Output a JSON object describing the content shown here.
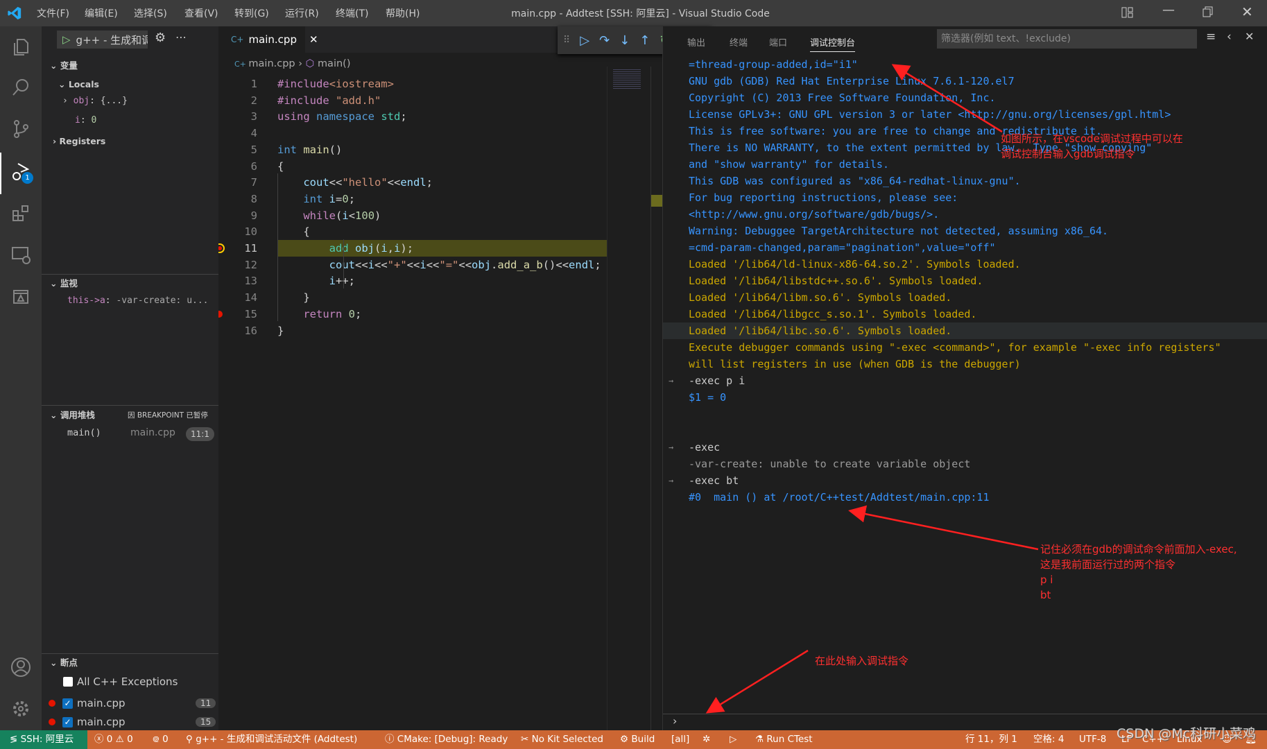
{
  "window": {
    "title": "main.cpp - Addtest [SSH: 阿里云] - Visual Studio Code",
    "menu": [
      "文件(F)",
      "编辑(E)",
      "选择(S)",
      "查看(V)",
      "转到(G)",
      "运行(R)",
      "终端(T)",
      "帮助(H)"
    ]
  },
  "sidebar": {
    "run_config": "g++ - 生成和调",
    "variables": {
      "title": "变量",
      "locals_label": "Locals",
      "items": [
        {
          "name": "obj",
          "value": "{...}"
        },
        {
          "name": "i",
          "value": "0"
        }
      ],
      "registers_label": "Registers"
    },
    "watch": {
      "title": "监视",
      "items": [
        {
          "expr": "this->a",
          "value": "-var-create: u..."
        }
      ]
    },
    "callstack": {
      "title": "调用堆栈",
      "status": "因 BREAKPOINT 已暂停",
      "frames": [
        {
          "name": "main()",
          "file": "main.cpp",
          "pos": "11:1"
        }
      ]
    },
    "breakpoints": {
      "title": "断点",
      "exceptions": {
        "label": "All C++ Exceptions",
        "checked": false
      },
      "items": [
        {
          "file": "main.cpp",
          "line": "11",
          "checked": true
        },
        {
          "file": "main.cpp",
          "line": "15",
          "checked": true
        }
      ]
    }
  },
  "activity_badge": "1",
  "editor": {
    "tab": "main.cpp",
    "breadcrumb": [
      "main.cpp",
      "main()"
    ],
    "current_line": 11,
    "breakpoint_lines": [
      15
    ],
    "lines": [
      [
        [
          "#include",
          "k"
        ],
        [
          "<iostream>",
          "s"
        ]
      ],
      [
        [
          "#include ",
          "k"
        ],
        [
          "\"add.h\"",
          "s"
        ]
      ],
      [
        [
          "using ",
          "k"
        ],
        [
          "namespace ",
          "b"
        ],
        [
          "std",
          "t"
        ],
        [
          ";",
          "d"
        ]
      ],
      [],
      [
        [
          "int ",
          "b"
        ],
        [
          "main",
          "f"
        ],
        [
          "()",
          "d"
        ]
      ],
      [
        [
          "{",
          "d"
        ]
      ],
      [
        [
          "    ",
          "d"
        ],
        [
          "cout",
          "v"
        ],
        [
          "<<",
          "d"
        ],
        [
          "\"hello\"",
          "s"
        ],
        [
          "<<",
          "d"
        ],
        [
          "endl",
          "v"
        ],
        [
          ";",
          "d"
        ]
      ],
      [
        [
          "    ",
          "d"
        ],
        [
          "int ",
          "b"
        ],
        [
          "i",
          "v"
        ],
        [
          "=",
          "d"
        ],
        [
          "0",
          "n"
        ],
        [
          ";",
          "d"
        ]
      ],
      [
        [
          "    ",
          "d"
        ],
        [
          "while",
          "k"
        ],
        [
          "(",
          "d"
        ],
        [
          "i",
          "v"
        ],
        [
          "<",
          "d"
        ],
        [
          "100",
          "n"
        ],
        [
          ")",
          "d"
        ]
      ],
      [
        [
          "    ",
          "d"
        ],
        [
          "{",
          "d"
        ]
      ],
      [
        [
          "        ",
          "d"
        ],
        [
          "add ",
          "t"
        ],
        [
          "obj",
          "v"
        ],
        [
          "(",
          "d"
        ],
        [
          "i",
          "v"
        ],
        [
          ",",
          "d"
        ],
        [
          "i",
          "v"
        ],
        [
          ");",
          "d"
        ]
      ],
      [
        [
          "        ",
          "d"
        ],
        [
          "cout",
          "v"
        ],
        [
          "<<",
          "d"
        ],
        [
          "i",
          "v"
        ],
        [
          "<<",
          "d"
        ],
        [
          "\"+\"",
          "s"
        ],
        [
          "<<",
          "d"
        ],
        [
          "i",
          "v"
        ],
        [
          "<<",
          "d"
        ],
        [
          "\"=\"",
          "s"
        ],
        [
          "<<",
          "d"
        ],
        [
          "obj",
          "v"
        ],
        [
          ".",
          "d"
        ],
        [
          "add_a_b",
          "f"
        ],
        [
          "()<<",
          "d"
        ],
        [
          "endl",
          "v"
        ],
        [
          ";",
          "d"
        ]
      ],
      [
        [
          "        ",
          "d"
        ],
        [
          "i",
          "v"
        ],
        [
          "++;",
          "d"
        ]
      ],
      [
        [
          "    ",
          "d"
        ],
        [
          "}",
          "d"
        ]
      ],
      [
        [
          "    ",
          "d"
        ],
        [
          "return ",
          "k"
        ],
        [
          "0",
          "n"
        ],
        [
          ";",
          "d"
        ]
      ],
      [
        [
          "}",
          "d"
        ]
      ]
    ]
  },
  "panel": {
    "tabs": [
      "输出",
      "终端",
      "端口",
      "调试控制台"
    ],
    "active_tab": 3,
    "filter_placeholder": "筛选器(例如 text、!exclude)",
    "console": [
      {
        "text": "=thread-group-added,id=\"i1\"",
        "color": "blue"
      },
      {
        "text": "GNU gdb (GDB) Red Hat Enterprise Linux 7.6.1-120.el7",
        "color": "blue"
      },
      {
        "text": "Copyright (C) 2013 Free Software Foundation, Inc.",
        "color": "blue"
      },
      {
        "text": "License GPLv3+: GNU GPL version 3 or later <http://gnu.org/licenses/gpl.html>",
        "color": "blue"
      },
      {
        "text": "This is free software: you are free to change and redistribute it.",
        "color": "blue"
      },
      {
        "text": "There is NO WARRANTY, to the extent permitted by law.  Type \"show copying\"",
        "color": "blue"
      },
      {
        "text": "and \"show warranty\" for details.",
        "color": "blue"
      },
      {
        "text": "This GDB was configured as \"x86_64-redhat-linux-gnu\".",
        "color": "blue"
      },
      {
        "text": "For bug reporting instructions, please see:",
        "color": "blue"
      },
      {
        "text": "<http://www.gnu.org/software/gdb/bugs/>.",
        "color": "blue"
      },
      {
        "text": "Warning: Debuggee TargetArchitecture not detected, assuming x86_64.",
        "color": "blue"
      },
      {
        "text": "=cmd-param-changed,param=\"pagination\",value=\"off\"",
        "color": "blue"
      },
      {
        "text": "Loaded '/lib64/ld-linux-x86-64.so.2'. Symbols loaded.",
        "color": "yellow"
      },
      {
        "text": "Loaded '/lib64/libstdc++.so.6'. Symbols loaded.",
        "color": "yellow"
      },
      {
        "text": "Loaded '/lib64/libm.so.6'. Symbols loaded.",
        "color": "yellow"
      },
      {
        "text": "Loaded '/lib64/libgcc_s.so.1'. Symbols loaded.",
        "color": "yellow"
      },
      {
        "text": "Loaded '/lib64/libc.so.6'. Symbols loaded.",
        "color": "yellow",
        "hover": true
      },
      {
        "text": "Execute debugger commands using \"-exec <command>\", for example \"-exec info registers\"",
        "color": "yellow"
      },
      {
        "text": "will list registers in use (when GDB is the debugger)",
        "color": "yellow"
      },
      {
        "text": "-exec p i",
        "color": "white",
        "input": true
      },
      {
        "text": "$1 = 0",
        "color": "blue"
      },
      {
        "text": "",
        "color": "blue"
      },
      {
        "text": "",
        "color": "blue"
      },
      {
        "text": "-exec",
        "color": "white",
        "input": true
      },
      {
        "text": "-var-create: unable to create variable object",
        "color": "grey"
      },
      {
        "text": "-exec bt",
        "color": "white",
        "input": true
      },
      {
        "text": "#0  main () at /root/C++test/Addtest/main.cpp:11",
        "color": "blue"
      }
    ]
  },
  "annotations": {
    "note1": "如图所示，在vscode调试过程中可以在\n调试控制台输入gdb调试指令",
    "note2": "记住必须在gdb的调试命令前面加入-exec,\n这是我前面运行过的两个指令\np i\nbt",
    "note3": "在此处输入调试指令",
    "color": "#ff3030"
  },
  "statusbar": {
    "remote": "SSH: 阿里云",
    "errors": "0",
    "warnings": "0",
    "ports": "0",
    "launch": "g++ - 生成和调试活动文件 (Addtest)",
    "cmake": "CMake: [Debug]: Ready",
    "kit": "No Kit Selected",
    "build": "Build",
    "target": "[all]",
    "ctest": "Run CTest",
    "position": "行 11，列 1",
    "spaces": "空格: 4",
    "encoding": "UTF-8",
    "eol": "LF",
    "language": "C++",
    "platform": "Linux",
    "watermark": "CSDN @Mc科研小菜鸡",
    "color": "#cc6633",
    "remote_color": "#16825d"
  }
}
